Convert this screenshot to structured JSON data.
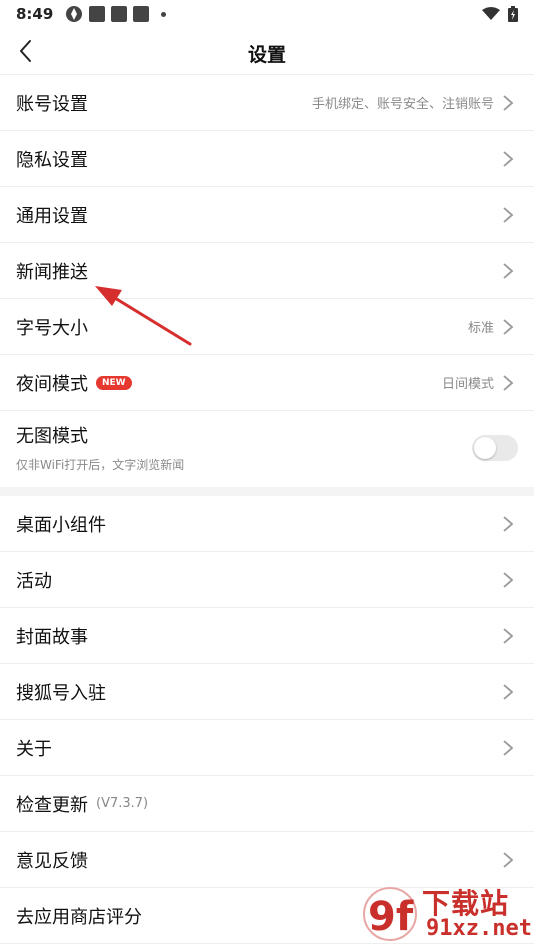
{
  "status_bar": {
    "time": "8:49",
    "left_icons": [
      "app-icon",
      "notification-icon",
      "notification-icon",
      "notification-icon",
      "dot-icon"
    ],
    "right_icons": [
      "wifi-icon",
      "battery-charging-icon"
    ]
  },
  "header": {
    "title": "设置",
    "back_icon": "chevron-left-icon"
  },
  "groups": [
    {
      "items": [
        {
          "label": "账号设置",
          "subtitle": "手机绑定、账号安全、注销账号"
        },
        {
          "label": "隐私设置"
        },
        {
          "label": "通用设置"
        },
        {
          "label": "新闻推送"
        },
        {
          "label": "字号大小",
          "subtitle": "标准"
        },
        {
          "label": "夜间模式",
          "badge": "NEW",
          "subtitle": "日间模式"
        },
        {
          "label": "无图模式",
          "description": "仅非WiFi打开后，文字浏览新闻",
          "toggle": false
        }
      ]
    },
    {
      "items": [
        {
          "label": "桌面小组件"
        },
        {
          "label": "活动"
        },
        {
          "label": "封面故事"
        },
        {
          "label": "搜狐号入驻"
        },
        {
          "label": "关于"
        },
        {
          "label": "检查更新",
          "version": "(V7.3.7)"
        },
        {
          "label": "意见反馈"
        },
        {
          "label": "去应用商店评分"
        }
      ]
    }
  ],
  "colors": {
    "accent_red": "#e5382f",
    "divider": "#eeeeee",
    "section_gap": "#f4f4f4",
    "annotation_arrow": "#d62d2d"
  },
  "watermark": {
    "logo_text": "9f",
    "title": "下载站",
    "url": "91xz.net"
  }
}
